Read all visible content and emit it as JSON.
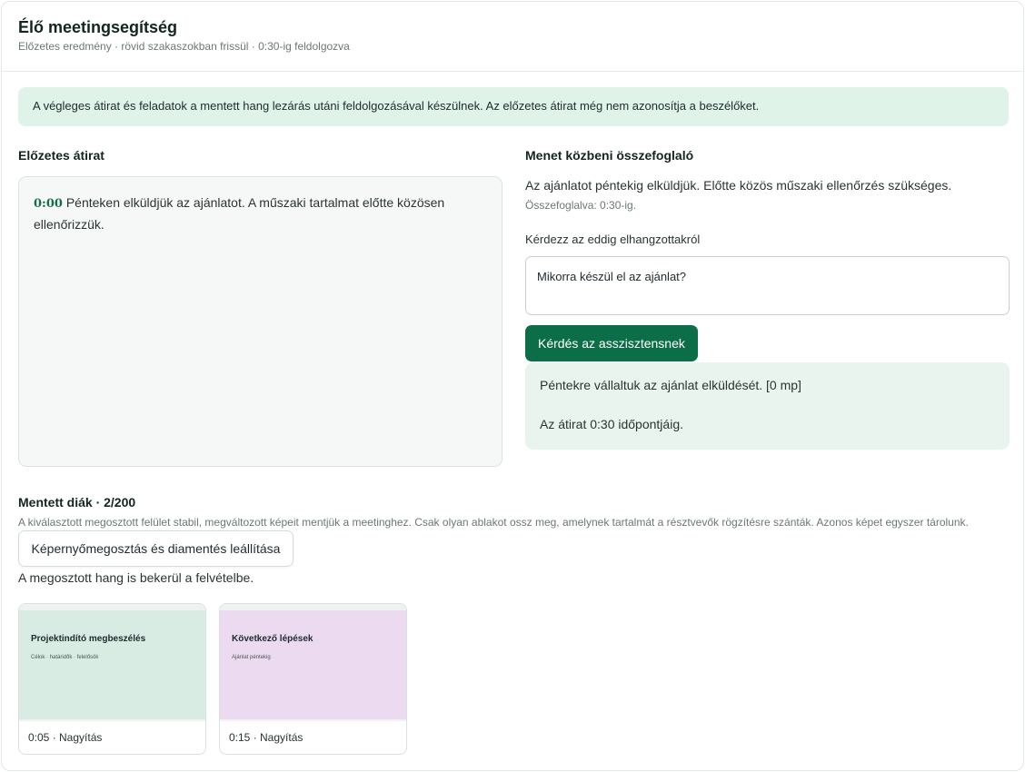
{
  "header": {
    "title": "Élő meetingsegítség",
    "subtitle": "Előzetes eredmény · rövid szakaszokban frissül · 0:30-ig feldolgozva"
  },
  "notice": "A végleges átirat és feladatok a mentett hang lezárás utáni feldolgozásával készülnek. Az előzetes átirat még nem azonosítja a beszélőket.",
  "transcript": {
    "heading": "Előzetes átirat",
    "entries": [
      {
        "time": "0:00",
        "text": "Pénteken elküldjük az ajánlatot. A műszaki tartalmat előtte közösen ellenőrizzük."
      }
    ]
  },
  "summary": {
    "heading": "Menet közbeni összefoglaló",
    "text": "Az ajánlatot péntekig elküldjük. Előtte közös műszaki ellenőrzés szükséges.",
    "meta": "Összefoglalva: 0:30-ig."
  },
  "ask": {
    "label": "Kérdezz az eddig elhangzottakról",
    "value": "Mikorra készül el az ajánlat?",
    "button": "Kérdés az asszisztensnek",
    "answer_line1": "Péntekre vállaltuk az ajánlat elküldését. [0 mp]",
    "answer_line2": "Az átirat 0:30 időpontjáig."
  },
  "slides": {
    "heading": "Mentett diák · 2/200",
    "description": "A kiválasztott megosztott felület stabil, megváltozott képeit mentjük a meetinghez. Csak olyan ablakot ossz meg, amelynek tartalmát a résztvevők rögzítésre szánták. Azonos képet egyszer tárolunk.",
    "stop_button": "Képernyőmegosztás és diamentés leállítása",
    "audio_note": "A megosztott hang is bekerül a felvételbe.",
    "items": [
      {
        "title": "Projektindító megbeszélés",
        "subtitle": "Célok · határidők · felelősök",
        "caption": "0:05 · Nagyítás",
        "color": "#d9ece3"
      },
      {
        "title": "Következő lépések",
        "subtitle": "Ajánlat péntekig",
        "caption": "0:15 · Nagyítás",
        "color": "#ecdaf1"
      }
    ]
  },
  "colors": {
    "accent": "#0c6e48",
    "notice_bg": "#dff3e9",
    "answer_bg": "#e9f4ee"
  }
}
